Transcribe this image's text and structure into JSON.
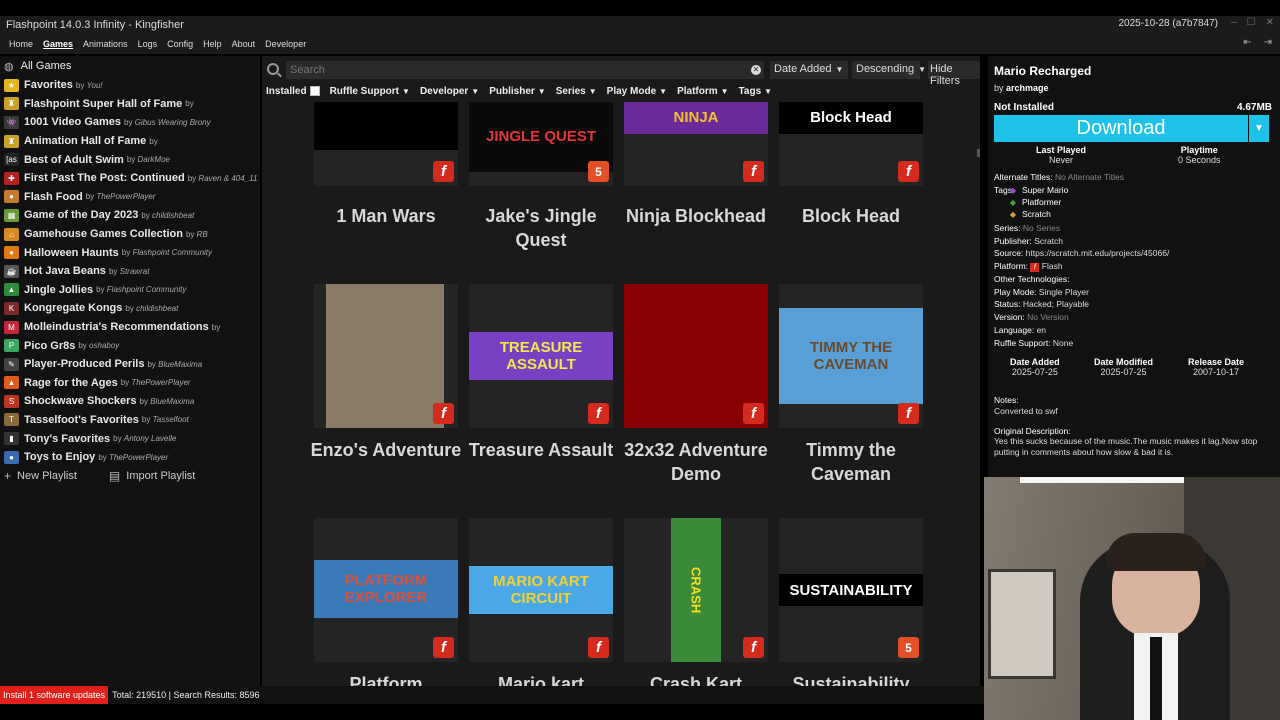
{
  "window": {
    "title": "Flashpoint 14.0.3 Infinity - Kingfisher",
    "version": "2025-10-28 (a7b7847)"
  },
  "menu": {
    "items": [
      "Home",
      "Games",
      "Animations",
      "Logs",
      "Config",
      "Help",
      "About",
      "Developer"
    ],
    "active": "Games"
  },
  "sidebar": {
    "all_games": "All Games",
    "playlists": [
      {
        "name": "Favorites",
        "by_prefix": "by",
        "author": "You!",
        "icon": "star-icon",
        "color": "#e6b820"
      },
      {
        "name": "Flashpoint Super Hall of Fame",
        "by_prefix": "by",
        "author": "",
        "icon": "trophy-icon",
        "color": "#c9a227"
      },
      {
        "name": "1001 Video Games",
        "by_prefix": "by",
        "author": "Gibus Wearing Brony",
        "icon": "invader-icon",
        "color": "#3a3a3a"
      },
      {
        "name": "Animation Hall of Fame",
        "by_prefix": "by",
        "author": "",
        "icon": "trophy-icon",
        "color": "#c9a227"
      },
      {
        "name": "Best of Adult Swim",
        "by_prefix": "by",
        "author": "DarkMoe",
        "icon": "as-logo-icon",
        "color": "#222222"
      },
      {
        "name": "First Past The Post: Continued",
        "by_prefix": "by",
        "author": "Raven & 404_11",
        "icon": "ribbon-icon",
        "color": "#b22222"
      },
      {
        "name": "Flash Food",
        "by_prefix": "by",
        "author": "ThePowerPlayer",
        "icon": "burger-icon",
        "color": "#c47a2c"
      },
      {
        "name": "Game of the Day 2023",
        "by_prefix": "by",
        "author": "childishbeat",
        "icon": "calendar-icon",
        "color": "#6a9a3a"
      },
      {
        "name": "Gamehouse Games Collection",
        "by_prefix": "by",
        "author": "RB",
        "icon": "house-icon",
        "color": "#d48a1e"
      },
      {
        "name": "Halloween Haunts",
        "by_prefix": "by",
        "author": "Flashpoint Community",
        "icon": "pumpkin-icon",
        "color": "#e07a10"
      },
      {
        "name": "Hot Java Beans",
        "by_prefix": "by",
        "author": "Strawrat",
        "icon": "coffee-icon",
        "color": "#555555"
      },
      {
        "name": "Jingle Jollies",
        "by_prefix": "by",
        "author": "Flashpoint Community",
        "icon": "tree-icon",
        "color": "#2e8b3a"
      },
      {
        "name": "Kongregate Kongs",
        "by_prefix": "by",
        "author": "childishbeat",
        "icon": "kong-icon",
        "color": "#7a2a2a"
      },
      {
        "name": "Molleindustria's Recommendations",
        "by_prefix": "by",
        "author": "",
        "icon": "molle-icon",
        "color": "#c0283a"
      },
      {
        "name": "Pico Gr8s",
        "by_prefix": "by",
        "author": "oshaboy",
        "icon": "pico-icon",
        "color": "#3aa860"
      },
      {
        "name": "Player-Produced Perils",
        "by_prefix": "by",
        "author": "BlueMaxima",
        "icon": "edit-icon",
        "color": "#444444"
      },
      {
        "name": "Rage for the Ages",
        "by_prefix": "by",
        "author": "ThePowerPlayer",
        "icon": "fire-icon",
        "color": "#e05a1a"
      },
      {
        "name": "Shockwave Shockers",
        "by_prefix": "by",
        "author": "BlueMaxima",
        "icon": "shockwave-icon",
        "color": "#b8361e"
      },
      {
        "name": "Tasselfoot's Favorites",
        "by_prefix": "by",
        "author": "Tasselfoot",
        "icon": "tassel-icon",
        "color": "#8a6a3a"
      },
      {
        "name": "Tony's Favorites",
        "by_prefix": "by",
        "author": "Antony Lavelle",
        "icon": "bookmark-icon",
        "color": "#333333"
      },
      {
        "name": "Toys to Enjoy",
        "by_prefix": "by",
        "author": "ThePowerPlayer",
        "icon": "toy-icon",
        "color": "#3a6ab0"
      }
    ],
    "new_playlist": "New Playlist",
    "import_playlist": "Import Playlist"
  },
  "search": {
    "placeholder": "Search",
    "sort_by": "Date Added",
    "order": "Descending",
    "hide_filters": "Hide Filters"
  },
  "filters": {
    "installed": "Installed",
    "items": [
      "Ruffle Support",
      "Developer",
      "Publisher",
      "Series",
      "Play Mode",
      "Platform",
      "Tags"
    ]
  },
  "games": [
    {
      "title": "1 Man Wars",
      "platform": "Flash",
      "platform_icon": "flash-icon",
      "art_text": "",
      "bg": "#000000",
      "fg": "#2ecc71"
    },
    {
      "title": "Jake's Jingle Quest",
      "platform": "HTML5",
      "platform_icon": "html5-icon",
      "art_text": "JINGLE QUEST",
      "bg": "#0a0a0a",
      "fg": "#e23636"
    },
    {
      "title": "Ninja Blockhead",
      "platform": "Flash",
      "platform_icon": "flash-icon",
      "art_text": "NINJA",
      "bg": "#6a2a9a",
      "fg": "#f2c230"
    },
    {
      "title": "Block Head",
      "platform": "Flash",
      "platform_icon": "flash-icon",
      "art_text": "Block Head",
      "bg": "#000000",
      "fg": "#ffffff"
    },
    {
      "title": "Enzo's Adventure",
      "platform": "Flash",
      "platform_icon": "flash-icon",
      "art_text": "",
      "bg": "#8a7a66",
      "fg": "#c9b08a"
    },
    {
      "title": "Treasure Assault",
      "platform": "Flash",
      "platform_icon": "flash-icon",
      "art_text": "TREASURE ASSAULT",
      "bg": "#7b3fc4",
      "fg": "#f4e84a"
    },
    {
      "title": "32x32 Adventure Demo",
      "platform": "Flash",
      "platform_icon": "flash-icon",
      "art_text": "",
      "bg": "#8a0000",
      "fg": "#aaaaaa"
    },
    {
      "title": "Timmy the Caveman",
      "platform": "Flash",
      "platform_icon": "flash-icon",
      "art_text": "TIMMY THE CAVEMAN",
      "bg": "#5aa0d8",
      "fg": "#6a4a2a"
    },
    {
      "title": "Platform",
      "platform": "Flash",
      "platform_icon": "flash-icon",
      "art_text": "PLATFORM EXPLORER",
      "bg": "#3a7ab8",
      "fg": "#d8503a"
    },
    {
      "title": "Mario kart",
      "platform": "Flash",
      "platform_icon": "flash-icon",
      "art_text": "MARIO KART CIRCUIT",
      "bg": "#4aa8e8",
      "fg": "#f4d030"
    },
    {
      "title": "Crash Kart",
      "platform": "Flash",
      "platform_icon": "flash-icon",
      "art_text": "CRASH",
      "bg": "#3a8a3a",
      "fg": "#f4e020"
    },
    {
      "title": "Sustainability",
      "platform": "HTML5",
      "platform_icon": "html5-icon",
      "art_text": "SUSTAINABILITY",
      "bg": "#000000",
      "fg": "#ffffff"
    }
  ],
  "details": {
    "title": "Mario Recharged",
    "by_prefix": "by",
    "author": "archmage",
    "install_status": "Not Installed",
    "size": "4.67MB",
    "download_label": "Download",
    "last_played_label": "Last Played",
    "last_played_value": "Never",
    "playtime_label": "Playtime",
    "playtime_value": "0 Seconds",
    "alt_titles_label": "Alternate Titles:",
    "alt_titles_value": "No Alternate Titles",
    "tags_label": "Tags:",
    "tags": [
      "Super Mario",
      "Platformer",
      "Scratch"
    ],
    "series_label": "Series:",
    "series_value": "No Series",
    "publisher_label": "Publisher:",
    "publisher_value": "Scratch",
    "source_label": "Source:",
    "source_value": "https://scratch.mit.edu/projects/45066/",
    "platform_label": "Platform:",
    "platform_value": "Flash",
    "other_tech_label": "Other Technologies:",
    "play_mode_label": "Play Mode:",
    "play_mode_value": "Single Player",
    "status_label": "Status:",
    "status_value": "Hacked; Playable",
    "version_label": "Version:",
    "version_value": "No Version",
    "language_label": "Language:",
    "language_value": "en",
    "ruffle_label": "Ruffle Support:",
    "ruffle_value": "None",
    "date_added_label": "Date Added",
    "date_added_value": "2025-07-25",
    "date_modified_label": "Date Modified",
    "date_modified_value": "2025-07-25",
    "release_date_label": "Release Date",
    "release_date_value": "2007-10-17",
    "notes_label": "Notes:",
    "notes_value": "Converted to swf",
    "orig_desc_label": "Original Description:",
    "orig_desc_value": "Yes this sucks because of the music.The music makes it lag.Now stop putting in comments about how slow & bad it is."
  },
  "status": {
    "update_button": "Install 1 software updates",
    "totals": "Total: 219510 | Search Results: 8596"
  },
  "colors": {
    "accent": "#1ec2e8",
    "update": "#e0201b",
    "flash": "#d42b1e",
    "html5": "#e34f26"
  }
}
